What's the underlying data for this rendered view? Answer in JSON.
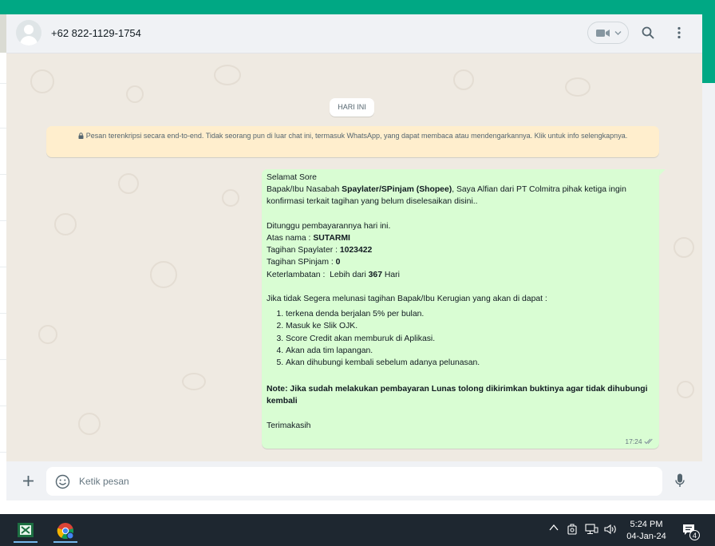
{
  "header": {
    "contact_name": "+62 822-1129-1754"
  },
  "chat": {
    "day_pill": "HARI INI",
    "encryption_notice": "Pesan terenkripsi secara end-to-end. Tidak seorang pun di luar chat ini, termasuk WhatsApp, yang dapat membaca atau mendengarkannya. Klik untuk info selengkapnya.",
    "message": {
      "greeting": "Selamat Sore",
      "intro_prefix": "Bapak/Ibu Nasabah ",
      "intro_bold": "Spaylater/SPinjam (Shopee)",
      "intro_suffix": ", Saya Alfian dari PT Colmitra pihak ketiga ingin konfirmasi terkait tagihan yang belum diselesaikan disini..",
      "wait_line": "Ditunggu pembayarannya hari ini.",
      "name_label": "Atas nama : ",
      "name_value": "SUTARMI",
      "spaylater_label": "Tagihan Spaylater : ",
      "spaylater_value": "1023422",
      "spinjam_label": "Tagihan SPinjam : ",
      "spinjam_value": "0",
      "late_label": "Keterlambatan :  Lebih dari ",
      "late_value": "367",
      "late_suffix": " Hari",
      "warning": "Jika tidak Segera melunasi tagihan Bapak/Ibu Kerugian yang akan di dapat :",
      "consequences": [
        "terkena denda berjalan 5% per bulan.",
        "Masuk ke Slik OJK.",
        "Score Credit akan memburuk di Aplikasi.",
        "Akan ada tim lapangan."
      ],
      "consequence_last": "Akan dihubungi kembali sebelum adanya pelunasan.",
      "note": "Note: Jika sudah melakukan pembayaran Lunas tolong dikirimkan buktinya agar tidak dihubungi kembali",
      "closing": "Terimakasih",
      "time": "17:24"
    }
  },
  "composer": {
    "placeholder": "Ketik pesan"
  },
  "taskbar": {
    "time": "5:24 PM",
    "date": "04-Jan-24",
    "notification_count": "4"
  },
  "colors": {
    "whatsapp_green": "#00a884",
    "bubble_out": "#d9fdd3",
    "notice_bg": "#ffeecd",
    "read_ticks": "#53bdeb"
  }
}
